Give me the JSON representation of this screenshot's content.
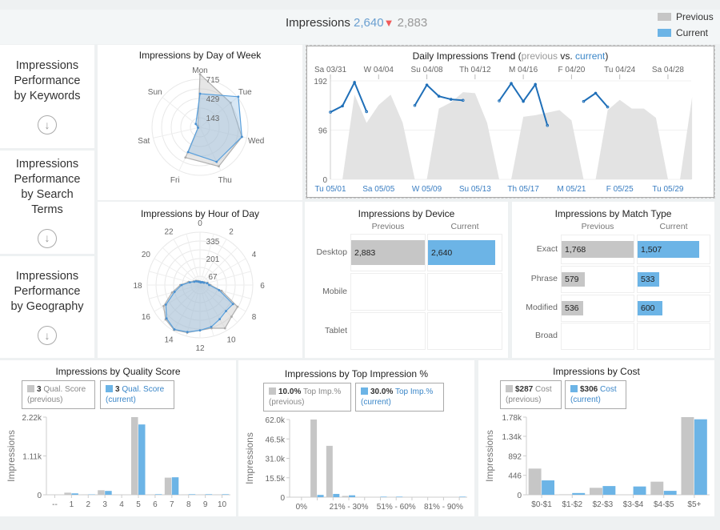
{
  "colors": {
    "previous": "#c6c6c6",
    "current": "#6cb4e6",
    "current_line": "#1f6fb8",
    "down_arrow": "#f05a5a"
  },
  "header": {
    "metric": "Impressions",
    "current_value": "2,640",
    "trend_icon": "down-triangle",
    "trend_glyph": "▼",
    "previous_value": "2,883"
  },
  "legend": {
    "previous": "Previous",
    "current": "Current"
  },
  "nav": [
    {
      "label": "Impressions Performance by Keywords",
      "icon": "circle-down-arrow"
    },
    {
      "label": "Impressions Performance by Search Terms",
      "icon": "circle-down-arrow"
    },
    {
      "label": "Impressions Performance by Geography",
      "icon": "circle-down-arrow"
    }
  ],
  "device": {
    "title": "Impressions by Device",
    "col_previous": "Previous",
    "col_current": "Current",
    "rows": [
      {
        "label": "Desktop",
        "previous": 2883,
        "previous_text": "2,883",
        "current": 2640,
        "current_text": "2,640"
      },
      {
        "label": "Mobile",
        "previous": null,
        "previous_text": "",
        "current": null,
        "current_text": ""
      },
      {
        "label": "Tablet",
        "previous": null,
        "previous_text": "",
        "current": null,
        "current_text": ""
      }
    ]
  },
  "match": {
    "title": "Impressions by Match Type",
    "col_previous": "Previous",
    "col_current": "Current",
    "rows": [
      {
        "label": "Exact",
        "previous": 1768,
        "previous_text": "1,768",
        "current": 1507,
        "current_text": "1,507"
      },
      {
        "label": "Phrase",
        "previous": 579,
        "previous_text": "579",
        "current": 533,
        "current_text": "533"
      },
      {
        "label": "Modified",
        "previous": 536,
        "previous_text": "536",
        "current": 600,
        "current_text": "600"
      },
      {
        "label": "Broad",
        "previous": null,
        "previous_text": "",
        "current": null,
        "current_text": ""
      }
    ]
  },
  "legend_boxes": {
    "quality": {
      "prev_value": "3",
      "prev_label": "Qual. Score",
      "prev_sub": "(previous)",
      "cur_value": "3",
      "cur_label": "Qual. Score",
      "cur_sub": "(current)"
    },
    "topimp": {
      "prev_value": "10.0%",
      "prev_label": "Top Imp.%",
      "prev_sub": "(previous)",
      "cur_value": "30.0%",
      "cur_label": "Top Imp.%",
      "cur_sub": "(current)"
    },
    "cost": {
      "prev_value": "$287",
      "prev_label": "Cost",
      "prev_sub": "(previous)",
      "cur_value": "$306",
      "cur_label": "Cost",
      "cur_sub": "(current)"
    }
  },
  "chart_data": [
    {
      "id": "dow",
      "type": "radar",
      "title": "Impressions by Day of Week",
      "axes": [
        "Mon",
        "Tue",
        "Wed",
        "Thu",
        "Fri",
        "Sat",
        "Sun"
      ],
      "rings": [
        143,
        286,
        429,
        572,
        715
      ],
      "ring_labels": [
        {
          "value": 143,
          "label": "143"
        },
        {
          "value": 429,
          "label": "429"
        },
        {
          "value": 715,
          "label": "715"
        }
      ],
      "series": [
        {
          "name": "Previous",
          "values": [
            790,
            585,
            640,
            645,
            500,
            30,
            40
          ]
        },
        {
          "name": "Current",
          "values": [
            500,
            730,
            640,
            570,
            410,
            30,
            80
          ]
        }
      ]
    },
    {
      "id": "hour",
      "type": "radar",
      "title": "Impressions by Hour of Day",
      "axes": [
        "0",
        "",
        "2",
        "",
        "4",
        "",
        "6",
        "",
        "8",
        "",
        "10",
        "",
        "12",
        "",
        "14",
        "",
        "16",
        "",
        "18",
        "",
        "20",
        "",
        "22",
        ""
      ],
      "rings": [
        67,
        134,
        201,
        268,
        335,
        402
      ],
      "ring_labels": [
        {
          "value": 67,
          "label": "67"
        },
        {
          "value": 201,
          "label": "201"
        },
        {
          "value": 335,
          "label": "335"
        }
      ],
      "series": [
        {
          "name": "Previous",
          "values": [
            25,
            22,
            25,
            30,
            40,
            60,
            80,
            170,
            330,
            340,
            380,
            340,
            345,
            375,
            395,
            370,
            320,
            220,
            150,
            90,
            55,
            45,
            35,
            28
          ]
        },
        {
          "name": "Current",
          "values": [
            25,
            20,
            25,
            30,
            35,
            55,
            70,
            150,
            290,
            280,
            300,
            330,
            345,
            370,
            390,
            360,
            300,
            200,
            140,
            80,
            50,
            40,
            30,
            25
          ]
        }
      ]
    },
    {
      "id": "trend",
      "type": "area+line",
      "title": {
        "prefix": "Daily Impressions Trend (",
        "previous": "previous",
        "mid": " vs. ",
        "current": "current",
        "suffix": ")"
      },
      "ylim": [
        0,
        192
      ],
      "y_ticks": [
        {
          "value": 0,
          "label": "0"
        },
        {
          "value": 96,
          "label": "96"
        },
        {
          "value": 192,
          "label": "192"
        }
      ],
      "top_ticks": [
        {
          "index": 0,
          "label": "Sa 03/31"
        },
        {
          "index": 4,
          "label": "W 04/04"
        },
        {
          "index": 8,
          "label": "Su 04/08"
        },
        {
          "index": 12,
          "label": "Th 04/12"
        },
        {
          "index": 16,
          "label": "M 04/16"
        },
        {
          "index": 20,
          "label": "F 04/20"
        },
        {
          "index": 24,
          "label": "Tu 04/24"
        },
        {
          "index": 28,
          "label": "Sa 04/28"
        }
      ],
      "bottom_ticks": [
        {
          "index": 0,
          "label": "Tu 05/01"
        },
        {
          "index": 4,
          "label": "Sa 05/05"
        },
        {
          "index": 8,
          "label": "W 05/09"
        },
        {
          "index": 12,
          "label": "Su 05/13"
        },
        {
          "index": 16,
          "label": "Th 05/17"
        },
        {
          "index": 20,
          "label": "M 05/21"
        },
        {
          "index": 24,
          "label": "F 05/25"
        },
        {
          "index": 28,
          "label": "Tu 05/29"
        }
      ],
      "series": [
        {
          "name": "previous",
          "values": [
            0,
            0,
            165,
            110,
            145,
            165,
            110,
            0,
            0,
            138,
            150,
            170,
            168,
            110,
            0,
            0,
            122,
            125,
            130,
            135,
            115,
            0,
            0,
            135,
            155,
            138,
            138,
            120,
            0,
            0,
            160
          ]
        },
        {
          "name": "current",
          "values": [
            131,
            143,
            189,
            132,
            null,
            null,
            null,
            144,
            184,
            162,
            156,
            154,
            null,
            null,
            153,
            187,
            152,
            185,
            105,
            null,
            null,
            152,
            168,
            141,
            null,
            null,
            null,
            null,
            null,
            null,
            null
          ]
        }
      ]
    },
    {
      "id": "quality",
      "type": "bar",
      "title": "Impressions by Quality Score",
      "ylabel": "Impressions",
      "categories": [
        "--",
        "1",
        "2",
        "3",
        "4",
        "5",
        "6",
        "7",
        "8",
        "9",
        "10"
      ],
      "ylim": [
        0,
        2220
      ],
      "y_ticks": [
        {
          "value": 0,
          "label": "0"
        },
        {
          "value": 1110,
          "label": "1.11k"
        },
        {
          "value": 2220,
          "label": "2.22k"
        }
      ],
      "series": [
        {
          "name": "previous",
          "values": [
            0,
            60,
            10,
            130,
            0,
            2220,
            10,
            490,
            10,
            10,
            10
          ]
        },
        {
          "name": "current",
          "values": [
            0,
            40,
            10,
            110,
            0,
            2010,
            15,
            500,
            15,
            15,
            15
          ]
        }
      ]
    },
    {
      "id": "topimp",
      "type": "bar",
      "title": "Impressions by Top Impression %",
      "ylabel": "Impressions",
      "categories": [
        "0%",
        "",
        "",
        "21% - 30%",
        "",
        "",
        "51% - 60%",
        "",
        "",
        "81% - 90%",
        ""
      ],
      "ylim": [
        0,
        62000
      ],
      "y_ticks": [
        {
          "value": 0,
          "label": "0"
        },
        {
          "value": 15500,
          "label": "15.5k"
        },
        {
          "value": 31000,
          "label": "31.0k"
        },
        {
          "value": 46500,
          "label": "46.5k"
        },
        {
          "value": 62000,
          "label": "62.0k"
        }
      ],
      "series": [
        {
          "name": "previous",
          "values": [
            0,
            62000,
            41000,
            1000,
            0,
            0,
            0,
            0,
            0,
            0,
            0
          ]
        },
        {
          "name": "current",
          "values": [
            0,
            1800,
            2600,
            1500,
            0,
            400,
            400,
            0,
            0,
            0,
            400
          ]
        }
      ]
    },
    {
      "id": "cost",
      "type": "bar",
      "title": "Impressions by Cost",
      "ylabel": "Impressions",
      "categories": [
        "$0-$1",
        "$1-$2",
        "$2-$3",
        "$3-$4",
        "$4-$5",
        "$5+"
      ],
      "ylim": [
        0,
        1780
      ],
      "y_ticks": [
        {
          "value": 0,
          "label": "0"
        },
        {
          "value": 446,
          "label": "446"
        },
        {
          "value": 892,
          "label": "892"
        },
        {
          "value": 1340,
          "label": "1.34k"
        },
        {
          "value": 1780,
          "label": "1.78k"
        }
      ],
      "series": [
        {
          "name": "previous",
          "values": [
            600,
            10,
            160,
            0,
            300,
            1780
          ]
        },
        {
          "name": "current",
          "values": [
            330,
            40,
            200,
            190,
            90,
            1730
          ]
        }
      ]
    }
  ]
}
